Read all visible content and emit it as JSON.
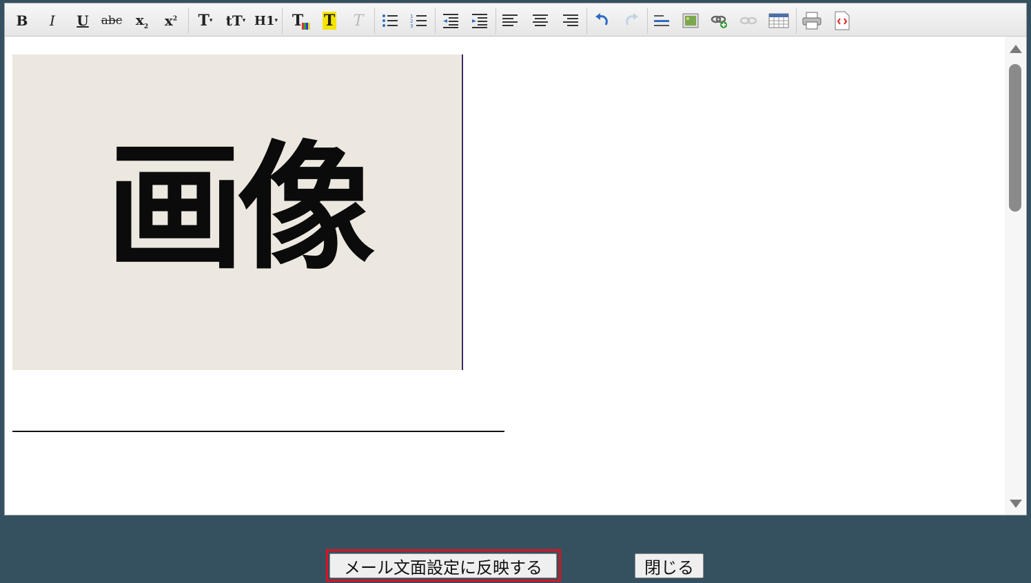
{
  "toolbar": {
    "bold": "B",
    "italic": "I",
    "underline": "U",
    "strike": "abc",
    "subscript_base": "x",
    "subscript_mark": "2",
    "superscript_base": "x",
    "superscript_mark": "2",
    "font_size": "T",
    "font_family": "tT",
    "heading": "H1",
    "text_color": "T",
    "highlight": "T",
    "remove_format": "T"
  },
  "content": {
    "image_text": "画像"
  },
  "buttons": {
    "apply": "メール文面設定に反映する",
    "close": "閉じる"
  },
  "colors": {
    "background": "#35515f",
    "highlight_outline": "#e01020",
    "image_bg": "#ece8e0"
  }
}
